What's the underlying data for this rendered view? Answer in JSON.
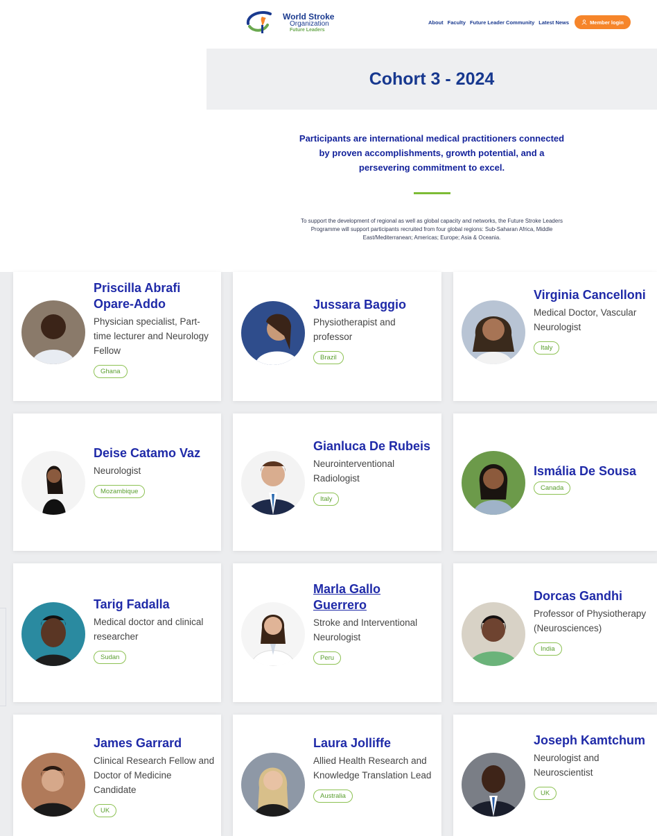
{
  "header": {
    "logo_line1": "World Stroke",
    "logo_line2": "Organization",
    "logo_line3": "Future Leaders",
    "nav": [
      "About",
      "Faculty",
      "Future Leader Community",
      "Latest News"
    ],
    "login_label": "Member login"
  },
  "banner": {
    "title": "Cohort 3 - 2024"
  },
  "intro": {
    "lead": "Participants are international medical practitioners connected by proven accomplishments, growth potential, and a persevering commitment to excel.",
    "description": "To support the development of regional as well as global capacity and networks, the Future Stroke Leaders Programme will support participants recruited from four global regions: Sub-Saharan Africa, Middle East/Mediterranean; Americas; Europe; Asia & Oceania."
  },
  "colors": {
    "accent": "#f6852a",
    "brand_blue": "#17388f",
    "green": "#7dbb35"
  },
  "participants": [
    {
      "name": "Priscilla Abrafi Opare-Addo",
      "role": "Physician specialist, Part-time lecturer and Neurology Fellow",
      "country": "Ghana"
    },
    {
      "name": "Jussara Baggio",
      "role": "Physiotherapist and professor",
      "country": "Brazil"
    },
    {
      "name": "Virginia Cancelloni",
      "role": "Medical Doctor, Vascular Neurologist",
      "country": "Italy"
    },
    {
      "name": "Deise Catamo Vaz",
      "role": "Neurologist",
      "country": "Mozambique"
    },
    {
      "name": "Gianluca De Rubeis",
      "role": "Neurointerventional Radiologist",
      "country": "Italy"
    },
    {
      "name": "Ismália De Sousa",
      "role": "",
      "country": "Canada"
    },
    {
      "name": "Tarig Fadalla",
      "role": "Medical doctor and clinical researcher",
      "country": "Sudan"
    },
    {
      "name": "Marla Gallo Guerrero",
      "role": "Stroke and Interventional Neurologist",
      "country": "Peru"
    },
    {
      "name": "Dorcas Gandhi",
      "role": "Professor of Physiotherapy (Neurosciences)",
      "country": "India"
    },
    {
      "name": "James Garrard",
      "role": "Clinical Research Fellow and Doctor of Medicine Candidate",
      "country": "UK"
    },
    {
      "name": "Laura Jolliffe",
      "role": "Allied Health Research and Knowledge Translation Lead",
      "country": "Australia"
    },
    {
      "name": "Joseph Kamtchum",
      "role": "Neurologist and Neuroscientist",
      "country": "UK"
    }
  ]
}
